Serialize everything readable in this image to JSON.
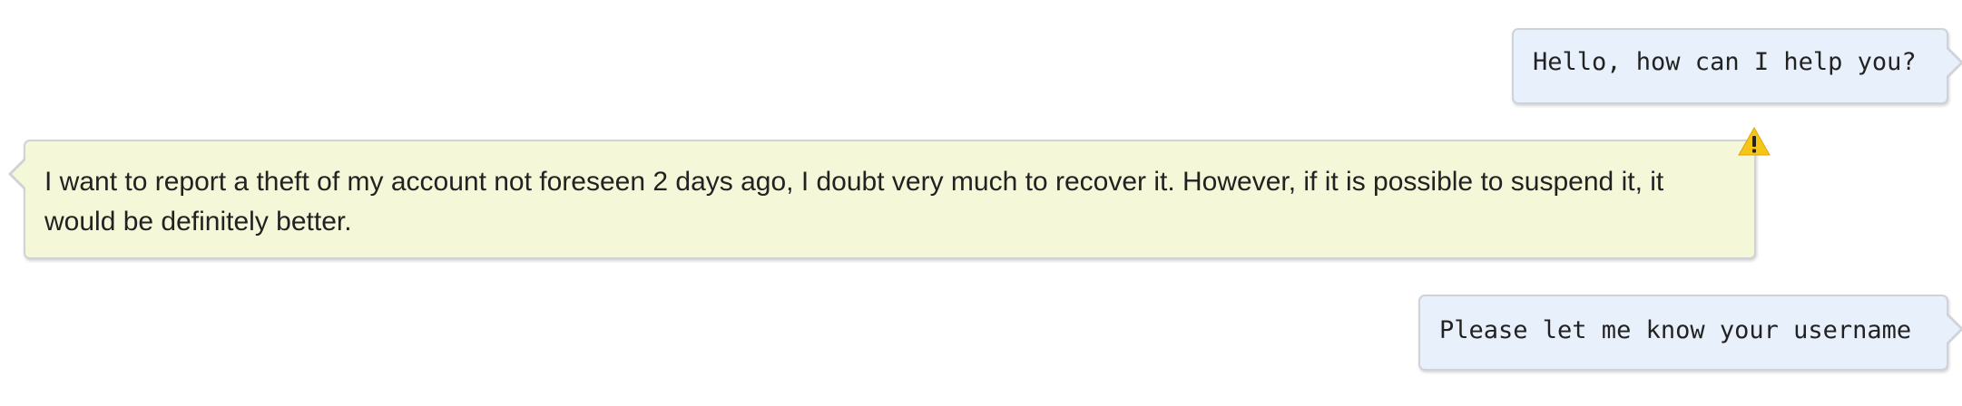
{
  "conversation": {
    "messages": [
      {
        "role": "agent",
        "text": "Hello, how can I help you?"
      },
      {
        "role": "user",
        "text": "I want to report a theft of my account not foreseen 2 days ago, I doubt very much to recover it. However, if it is possible to suspend it, it would be definitely better.",
        "flag_icon": "warning-icon"
      },
      {
        "role": "agent",
        "text": "Please let me know your username"
      }
    ]
  },
  "colors": {
    "agent_bubble": "#e8f0fb",
    "user_bubble": "#f5f7d9",
    "border": "#cfd3d8",
    "warning": "#f5c518"
  }
}
